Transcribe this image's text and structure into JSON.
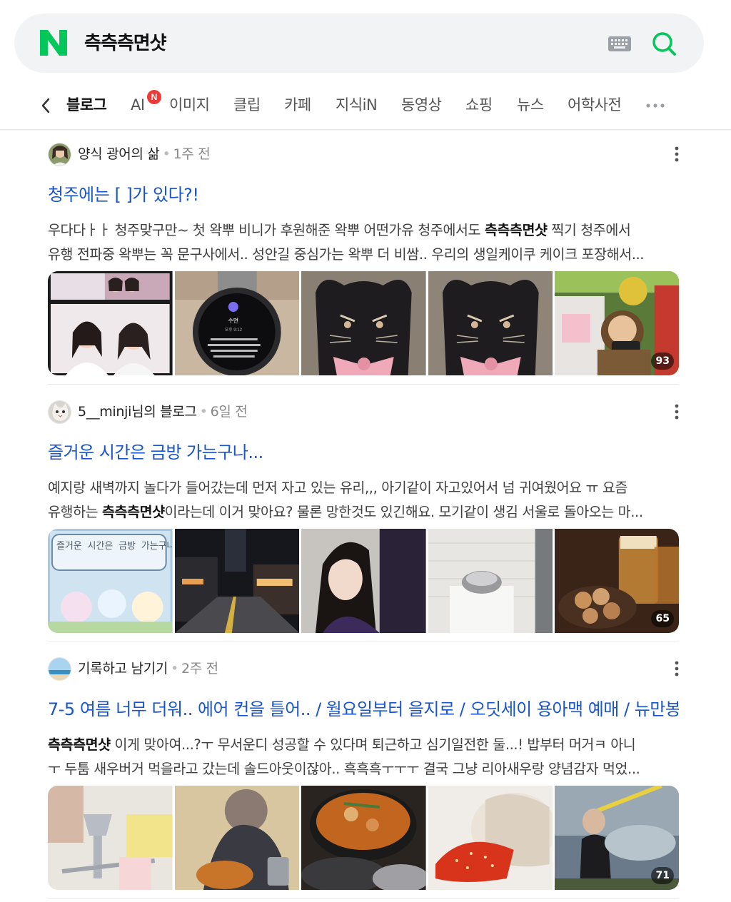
{
  "search": {
    "query": "측측측면샷"
  },
  "colors": {
    "brand": "#03c75a",
    "link": "#1a55c9",
    "badge": "#ea3b3b"
  },
  "icons": {
    "logo": "naver-logo",
    "keyboard": "keyboard-icon",
    "search": "search-icon",
    "back": "chevron-left-icon",
    "more": "more-dots-icon",
    "kebab": "kebab-menu-icon"
  },
  "tabs": [
    {
      "label": "블로그",
      "active": true
    },
    {
      "label": "AI",
      "badge": "N"
    },
    {
      "label": "이미지"
    },
    {
      "label": "클립"
    },
    {
      "label": "카페"
    },
    {
      "label": "지식iN"
    },
    {
      "label": "동영상"
    },
    {
      "label": "쇼핑"
    },
    {
      "label": "뉴스"
    },
    {
      "label": "어학사전"
    }
  ],
  "posts": [
    {
      "author": "양식 광어의 삶",
      "date": "1주 전",
      "title": "청주에는 [ ]가 있다?!",
      "desc_line1_pre": "우다다ㅏㅏ 청주맞구만~ 첫 왁뿌 비니가 후원해준 왁뿌 어떤가유 청주에서도 ",
      "desc_line1_bold": "측측측면샷",
      "desc_line1_post": " 찍기 청주에서",
      "desc_line2": "유행 전파중 왁뿌는 꼭 문구사에서.. 성안길 중심가는 왁뿌 더 비쌈.. 우리의 생일케이쿠 케이크 포장해서...",
      "photo_count": "93",
      "photo_texts": {
        "watch_title": "수면",
        "watch_time": "오후 9:12"
      }
    },
    {
      "author": "5__minji님의 블로그",
      "date": "6일 전",
      "title": "즐거운 시간은 금방 가는구나...",
      "desc_line1": "예지랑 새벽까지 놀다가 들어갔는데 먼저 자고 있는 유리,,, 아기같이 자고있어서 넘 귀여웠어요 ㅠ 요즘",
      "desc_line2_pre": "유행하는 ",
      "desc_line2_bold": "측측측면샷",
      "desc_line2_post": "이라는데 이거 맞아요? 물론 망한것도 있긴해요. 모기같이 생김 서울로 돌아오는 마...",
      "photo_count": "65",
      "photo_texts": {
        "game_bubble": "즐거운 시간은 금방 가는구나..."
      }
    },
    {
      "author": "기록하고 남기기",
      "date": "2주 전",
      "title": "7-5 여름 너무 더워.. 에어 컨을 틀어.. / 월요일부터 을지로 / 오딧세이 용아맥 예매 / 뉴만봉 ...",
      "desc_line1_bold": "측측측면샷",
      "desc_line1_post": " 이게 맞아여...?ㅜ 무서운디 성공할 수 있다며 퇴근하고 심기일전한 둘...! 밥부터 머거ㅋ 아니",
      "desc_line2": "ㅜ 두툼 새우버거 먹을라고 갔는데 솔드아웃이잖아.. 흑흑흑ㅜㅜㅜ 결국 그냥 리아새우랑 양념감자 먹었...",
      "photo_count": "71"
    }
  ]
}
